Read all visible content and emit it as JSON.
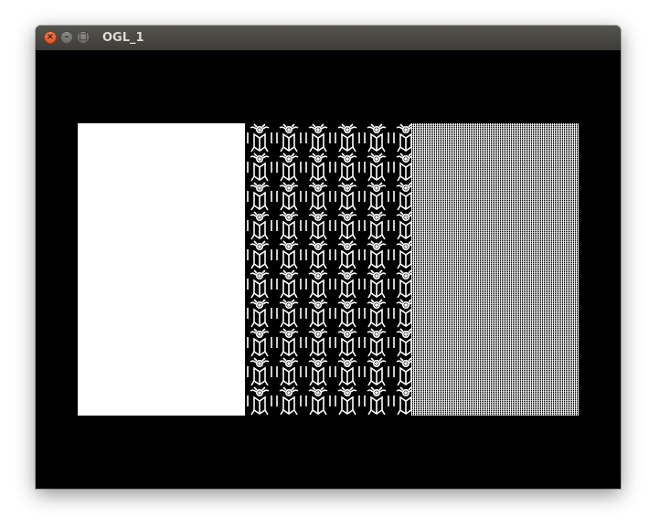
{
  "window": {
    "title": "OGL_1",
    "controls": {
      "close_glyph": "×",
      "minimize_glyph": "–",
      "maximize_glyph": "□"
    }
  },
  "canvas": {
    "background": "#000000",
    "quads": [
      {
        "name": "solid-white-quad",
        "fill": "#ffffff"
      },
      {
        "name": "bug-pattern-quad",
        "fill": "stipple",
        "foreground": "#ffffff",
        "background": "#000000"
      },
      {
        "name": "fine-stipple-quad",
        "fill": "checker",
        "foreground": "#ffffff",
        "background": "#000000"
      }
    ]
  }
}
